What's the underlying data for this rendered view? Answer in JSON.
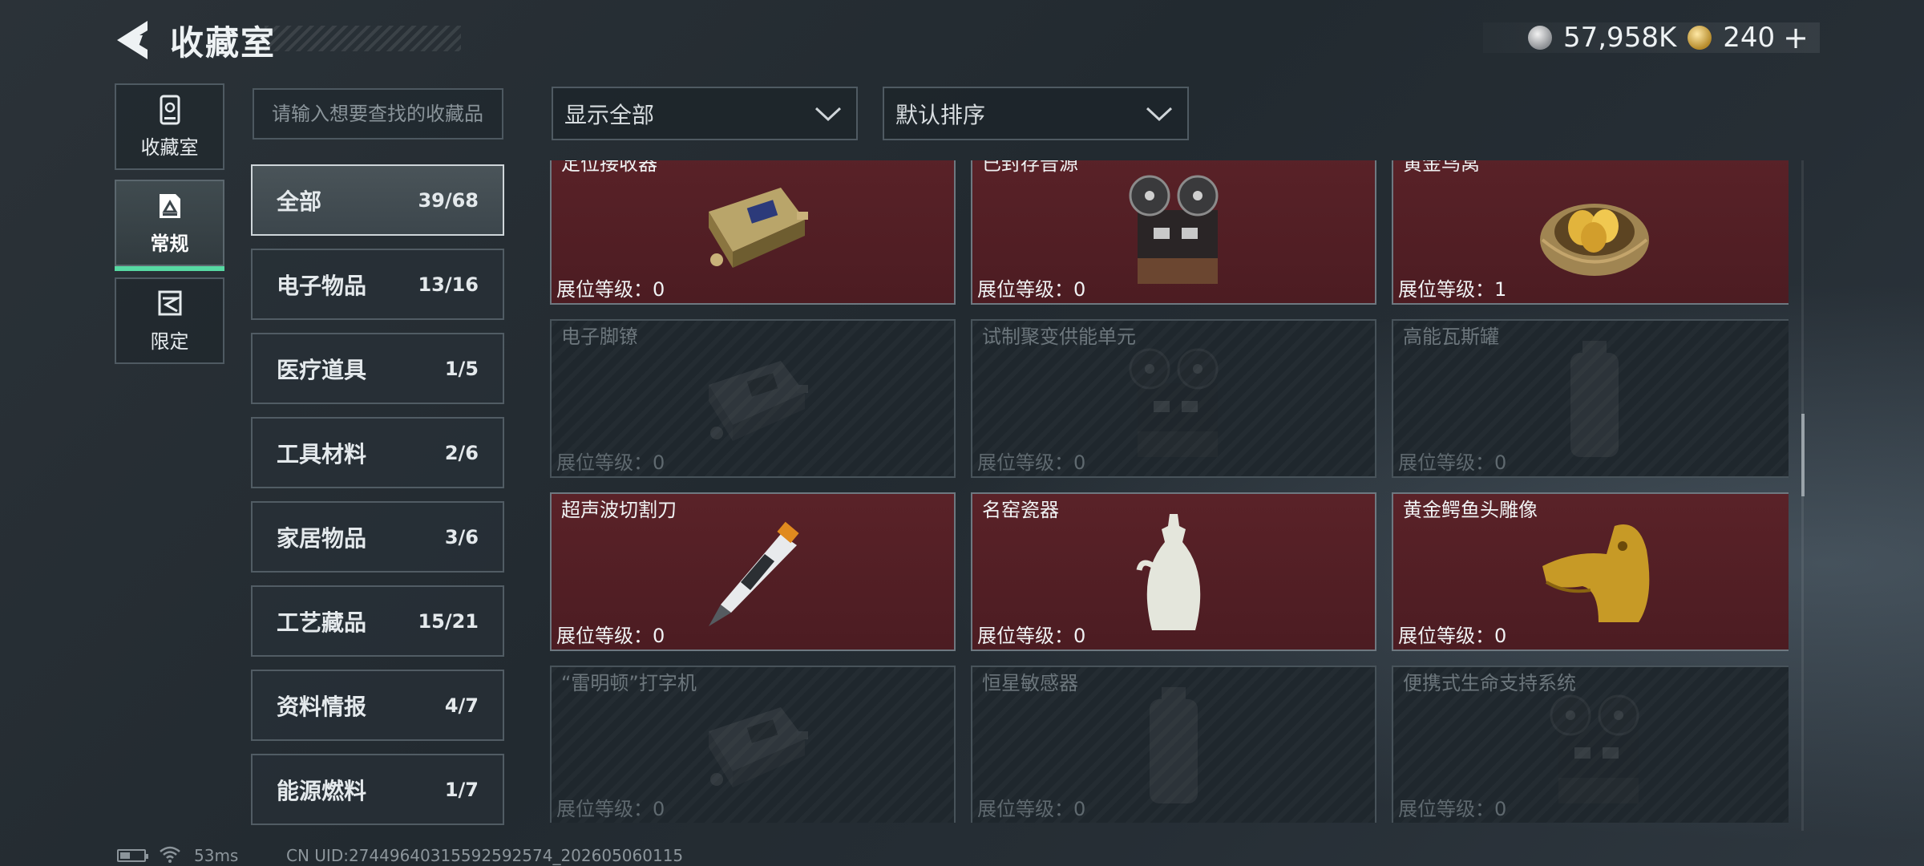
{
  "header": {
    "title": "收藏室",
    "currency": [
      {
        "icon": "silver-coin-icon",
        "value": "57,958K"
      },
      {
        "icon": "gold-coin-icon",
        "value": "240"
      }
    ],
    "add_label": "+"
  },
  "nav": {
    "items": [
      {
        "label": "收藏室",
        "icon": "vault-icon",
        "active": false
      },
      {
        "label": "常规",
        "icon": "gallery-icon",
        "active": true
      },
      {
        "label": "限定",
        "icon": "limited-icon",
        "active": false
      }
    ]
  },
  "search": {
    "placeholder": "请输入想要查找的收藏品"
  },
  "filters": {
    "display": "显示全部",
    "sort": "默认排序"
  },
  "categories": [
    {
      "name": "全部",
      "count": "39/68",
      "active": true
    },
    {
      "name": "电子物品",
      "count": "13/16"
    },
    {
      "name": "医疗道具",
      "count": "1/5"
    },
    {
      "name": "工具材料",
      "count": "2/6"
    },
    {
      "name": "家居物品",
      "count": "3/6"
    },
    {
      "name": "工艺藏品",
      "count": "15/21"
    },
    {
      "name": "资料情报",
      "count": "4/7"
    },
    {
      "name": "能源燃料",
      "count": "1/7"
    }
  ],
  "items": [
    {
      "name": "定位接收器",
      "level": "展位等级：0",
      "owned": true,
      "art": "receiver"
    },
    {
      "name": "已封存音源",
      "level": "展位等级：0",
      "owned": true,
      "art": "tape-deck"
    },
    {
      "name": "黄金鸟窝",
      "level": "展位等级：1",
      "owned": true,
      "art": "nest"
    },
    {
      "name": "电子脚镣",
      "level": "展位等级：0",
      "owned": false,
      "art": "receiver"
    },
    {
      "name": "试制聚变供能单元",
      "level": "展位等级：0",
      "owned": false,
      "art": "tape-deck"
    },
    {
      "name": "高能瓦斯罐",
      "level": "展位等级：0",
      "owned": false,
      "art": "canister"
    },
    {
      "name": "超声波切割刀",
      "level": "展位等级：0",
      "owned": true,
      "art": "knife"
    },
    {
      "name": "名窑瓷器",
      "level": "展位等级：0",
      "owned": true,
      "art": "vase"
    },
    {
      "name": "黄金鳄鱼头雕像",
      "level": "展位等级：0",
      "owned": true,
      "art": "croc"
    },
    {
      "name": "“雷明顿”打字机",
      "level": "展位等级：0",
      "owned": false,
      "art": "receiver"
    },
    {
      "name": "恒星敏感器",
      "level": "展位等级：0",
      "owned": false,
      "art": "canister"
    },
    {
      "name": "便携式生命支持系统",
      "level": "展位等级：0",
      "owned": false,
      "art": "tape-deck"
    }
  ],
  "footer": {
    "ping": "53ms",
    "uid": "CN UID:27449640315592592574_202605060115"
  }
}
